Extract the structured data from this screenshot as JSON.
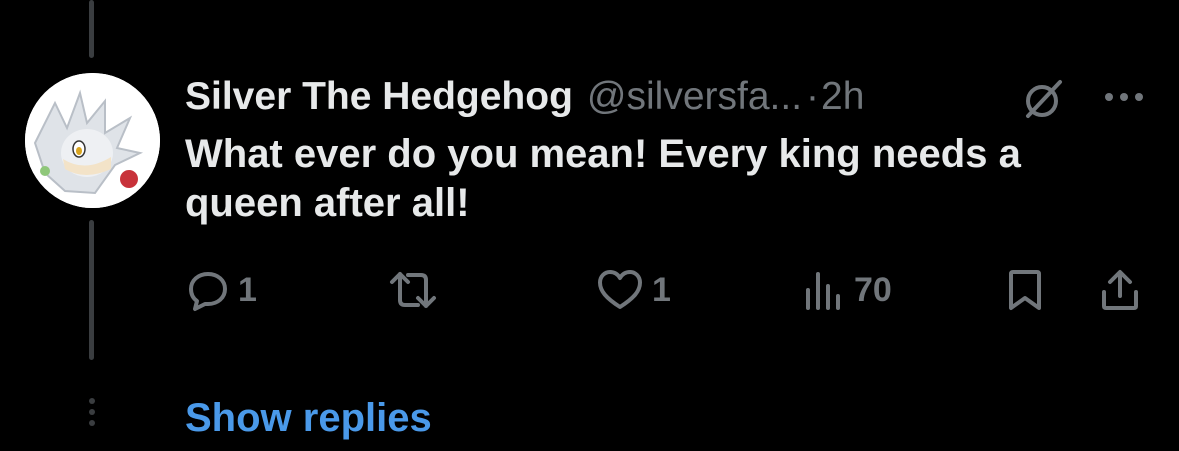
{
  "tweet": {
    "display_name": "Silver The Hedgehog",
    "handle": "@silversfa...",
    "separator": "·",
    "time": "2h",
    "text": "What ever do you mean! Every king needs a queen after all!",
    "icons": {
      "verified": "verified-badge-icon",
      "more": "more-options-icon",
      "avatar": "avatar-image"
    }
  },
  "actions": {
    "reply_count": "1",
    "retweet_count": "",
    "like_count": "1",
    "views_count": "70"
  },
  "show_replies_label": "Show replies",
  "colors": {
    "background": "#000000",
    "text_primary": "#e7e9ea",
    "text_secondary": "#71767b",
    "link": "#4a99e9",
    "thread_line": "#3a3d40"
  }
}
